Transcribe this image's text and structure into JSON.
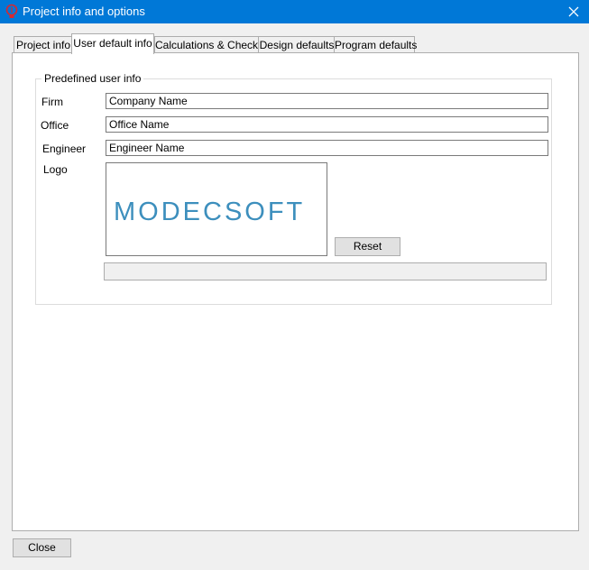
{
  "window": {
    "title": "Project info and options",
    "close_icon": "close-icon",
    "app_icon": "lightbulb-icon"
  },
  "tabs": [
    {
      "label": "Project info",
      "active": false
    },
    {
      "label": "User default info",
      "active": true
    },
    {
      "label": "Calculations & Checks",
      "active": false
    },
    {
      "label": "Design defaults",
      "active": false
    },
    {
      "label": "Program defaults",
      "active": false
    }
  ],
  "group": {
    "title": "Predefined user info",
    "firm_label": "Firm",
    "firm_value": "Company Name",
    "office_label": "Office",
    "office_value": "Office Name",
    "engineer_label": "Engineer",
    "engineer_value": "Engineer Name",
    "logo_label": "Logo",
    "logo_text": "MODECSOFT",
    "reset_label": "Reset",
    "logo_path": ""
  },
  "footer": {
    "close_label": "Close"
  },
  "colors": {
    "titlebar": "#0078d7",
    "logo": "#3d8fbd"
  }
}
